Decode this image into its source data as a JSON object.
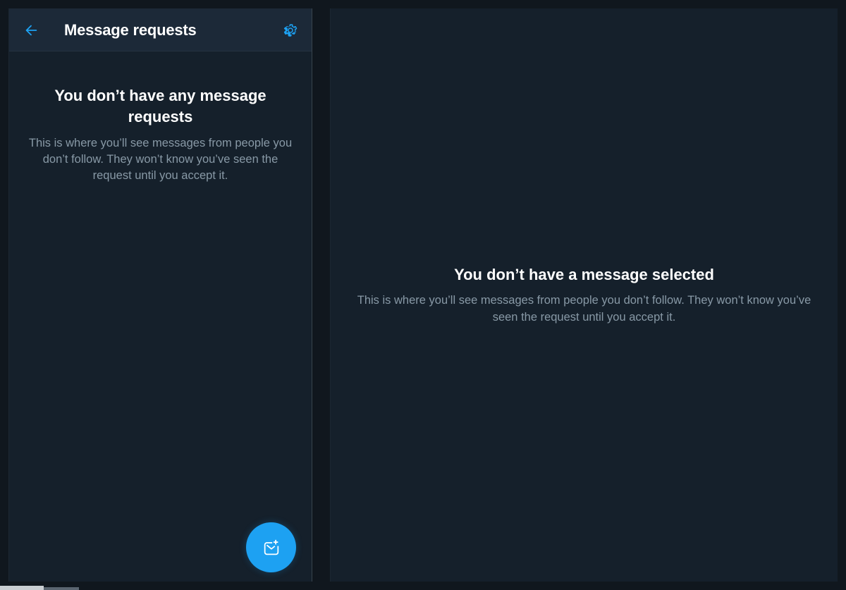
{
  "header": {
    "title": "Message requests",
    "back_icon": "arrow-left-icon",
    "settings_icon": "gear-icon"
  },
  "left_empty": {
    "title": "You don’t have any message requests",
    "description": "This is where you’ll see messages from people you don’t follow. They won’t know you’ve seen the request until you accept it."
  },
  "right_empty": {
    "title": "You don’t have a message selected",
    "description": "This is where you’ll see messages from people you don’t follow. They won’t know you’ve seen the request until you accept it."
  },
  "fab": {
    "icon": "new-message-icon"
  },
  "colors": {
    "accent": "#1da1f2",
    "background": "#15202b",
    "header_background": "#1c2938",
    "text_primary": "#ffffff",
    "text_secondary": "#8899a6"
  }
}
